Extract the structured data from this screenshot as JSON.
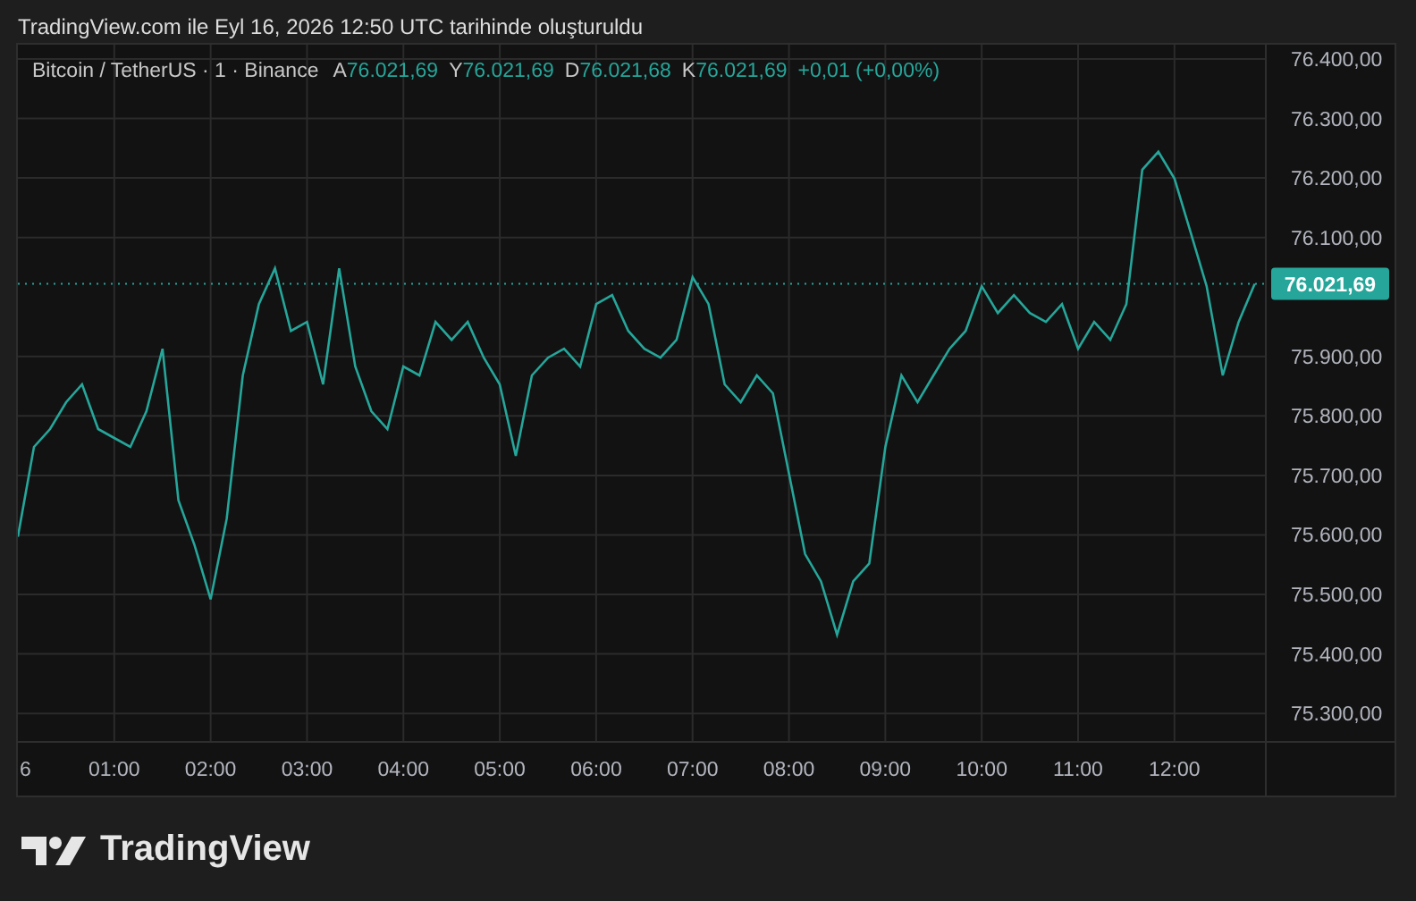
{
  "caption": "TradingView.com ile Eyl 16, 2026 12:50 UTC tarihinde oluşturuldu",
  "legend": {
    "ohlc": [
      {
        "label": "A",
        "value": "76.021,69"
      },
      {
        "label": "Y",
        "value": "76.021,69"
      },
      {
        "label": "D",
        "value": "76.021,68"
      },
      {
        "label": "K",
        "value": "76.021,69"
      }
    ],
    "change": "+0,01 (+0,00%)"
  },
  "chart_data": {
    "type": "line",
    "x": [
      0,
      10,
      20,
      30,
      40,
      50,
      60,
      70,
      80,
      90,
      100,
      110,
      120,
      130,
      140,
      150,
      160,
      170,
      180,
      190,
      200,
      210,
      220,
      230,
      240,
      250,
      260,
      270,
      280,
      290,
      300,
      310,
      320,
      330,
      340,
      350,
      360,
      370,
      380,
      390,
      400,
      410,
      420,
      430,
      440,
      450,
      460,
      470,
      480,
      490,
      500,
      510,
      520,
      530,
      540,
      550,
      560,
      570,
      580,
      590,
      600,
      610,
      620,
      630,
      640,
      650,
      660,
      670,
      680,
      690,
      700,
      710,
      720,
      730,
      740,
      750,
      760,
      770
    ],
    "series": [
      {
        "name": "Bitcoin / TetherUS · 1 · Binance",
        "color": "#26a69a",
        "values": [
          75597,
          75748,
          75778,
          75823,
          75853,
          75778,
          75763,
          75748,
          75808,
          75913,
          75658,
          75583,
          75492,
          75627,
          75868,
          75988,
          76048,
          75943,
          75958,
          75853,
          76048,
          75883,
          75808,
          75778,
          75883,
          75868,
          75958,
          75928,
          75958,
          75898,
          75853,
          75733,
          75868,
          75898,
          75913,
          75883,
          75988,
          76003,
          75943,
          75913,
          75898,
          75928,
          76033,
          75988,
          75853,
          75823,
          75868,
          75838,
          75703,
          75568,
          75522,
          75432,
          75522,
          75552,
          75748,
          75868,
          75823,
          75868,
          75913,
          75943,
          76018,
          75973,
          76003,
          75973,
          75958,
          75988,
          75913,
          75958,
          75928,
          75988,
          76214,
          76244,
          76199,
          76109,
          76018,
          75868,
          75958,
          76022
        ]
      }
    ],
    "grid": true,
    "xlim": [
      0,
      857
    ],
    "ylim": [
      75162,
      76424
    ],
    "xticks": [
      {
        "value": 60,
        "label": "01:00"
      },
      {
        "value": 120,
        "label": "02:00"
      },
      {
        "value": 180,
        "label": "03:00"
      },
      {
        "value": 240,
        "label": "04:00"
      },
      {
        "value": 300,
        "label": "05:00"
      },
      {
        "value": 360,
        "label": "06:00"
      },
      {
        "value": 420,
        "label": "07:00"
      },
      {
        "value": 480,
        "label": "08:00"
      },
      {
        "value": 540,
        "label": "09:00"
      },
      {
        "value": 600,
        "label": "10:00"
      },
      {
        "value": 660,
        "label": "11:00"
      },
      {
        "value": 720,
        "label": "12:00"
      }
    ],
    "yticks": [
      {
        "value": 76400,
        "label": "76.400,00"
      },
      {
        "value": 76300,
        "label": "76.300,00"
      },
      {
        "value": 76200,
        "label": "76.200,00"
      },
      {
        "value": 76100,
        "label": "76.100,00"
      },
      {
        "value": 75900,
        "label": "75.900,00"
      },
      {
        "value": 75800,
        "label": "75.800,00"
      },
      {
        "value": 75700,
        "label": "75.700,00"
      },
      {
        "value": 75600,
        "label": "75.600,00"
      },
      {
        "value": 75500,
        "label": "75.500,00"
      },
      {
        "value": 75400,
        "label": "75.400,00"
      },
      {
        "value": 75300,
        "label": "75.300,00"
      }
    ]
  },
  "day_label": "6",
  "last_price": "76.021,69",
  "brand": "TradingView"
}
